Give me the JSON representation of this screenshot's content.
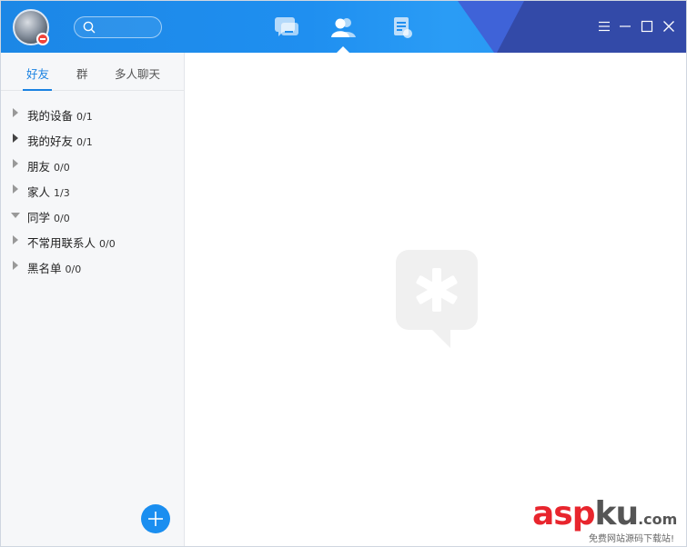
{
  "search": {
    "placeholder": ""
  },
  "nav": {
    "items": [
      {
        "name": "messages",
        "icon": "chat-bubbles-icon"
      },
      {
        "name": "contacts",
        "icon": "contacts-icon",
        "active": true
      },
      {
        "name": "feeds",
        "icon": "document-icon"
      }
    ]
  },
  "window_controls": [
    "menu-icon",
    "minimize-icon",
    "maximize-icon",
    "close-icon"
  ],
  "sidebar": {
    "tabs": [
      {
        "label": "好友",
        "active": true
      },
      {
        "label": "群"
      },
      {
        "label": "多人聊天"
      }
    ],
    "groups": [
      {
        "name": "我的设备",
        "count": "0/1",
        "state": "collapsed"
      },
      {
        "name": "我的好友",
        "count": "0/1",
        "state": "collapsed"
      },
      {
        "name": "朋友",
        "count": "0/0",
        "state": "collapsed"
      },
      {
        "name": "家人",
        "count": "1/3",
        "state": "collapsed"
      },
      {
        "name": "同学",
        "count": "0/0",
        "state": "expanded"
      },
      {
        "name": "不常用联系人",
        "count": "0/0",
        "state": "collapsed"
      },
      {
        "name": "黑名单",
        "count": "0/0",
        "state": "collapsed"
      }
    ]
  },
  "watermark": {
    "brand": "asp",
    "brand2": "ku",
    "suffix": ".com",
    "subtitle": "免费网站源码下载站!"
  },
  "colors": {
    "accent": "#1a82e2",
    "titlebar": "#1f8ff0",
    "status_busy": "#f0433a"
  }
}
